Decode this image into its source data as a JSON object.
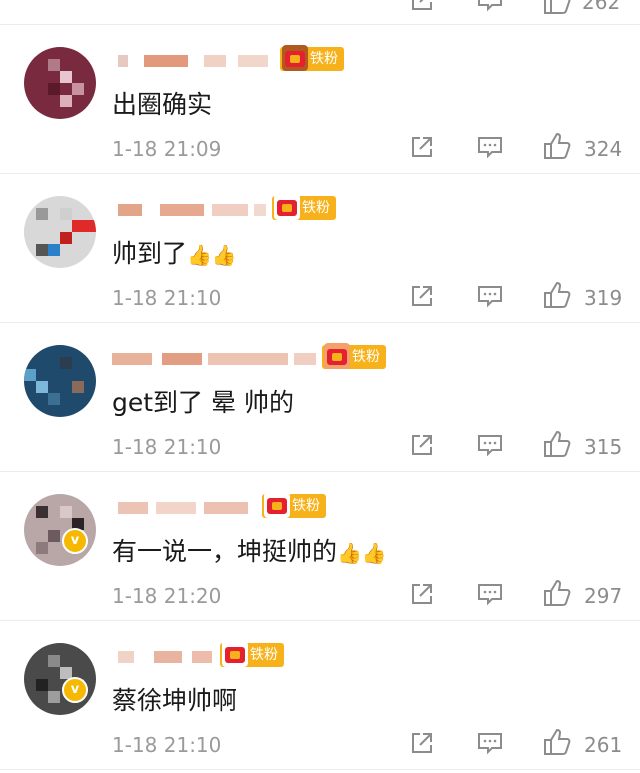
{
  "feed": {
    "prev_like_count": "262",
    "comments": [
      {
        "text": "出圈确实",
        "time": "1-18 21:09",
        "likes": "324",
        "badge": "铁粉",
        "verified": false
      },
      {
        "text": "帅到了",
        "emoji": "👍👍",
        "time": "1-18 21:10",
        "likes": "319",
        "badge": "铁粉",
        "verified": false
      },
      {
        "text": "get到了 晕 帅的",
        "time": "1-18 21:10",
        "likes": "315",
        "badge": "铁粉",
        "verified": false
      },
      {
        "text": "有一说一，坤挺帅的",
        "emoji": "👍👍",
        "time": "1-18 21:20",
        "likes": "297",
        "badge": "铁粉",
        "verified": true
      },
      {
        "text": "蔡徐坤帅啊",
        "time": "1-18 21:10",
        "likes": "261",
        "badge": "铁粉",
        "verified": true
      }
    ]
  },
  "icons": {
    "share": "share-icon",
    "reply": "comment-icon",
    "like": "thumbs-up-icon",
    "verified": "verified-v-icon"
  },
  "colors": {
    "badge": "#f7b21b",
    "verified": "#f6b800",
    "meta_text": "#9a9a9a"
  }
}
